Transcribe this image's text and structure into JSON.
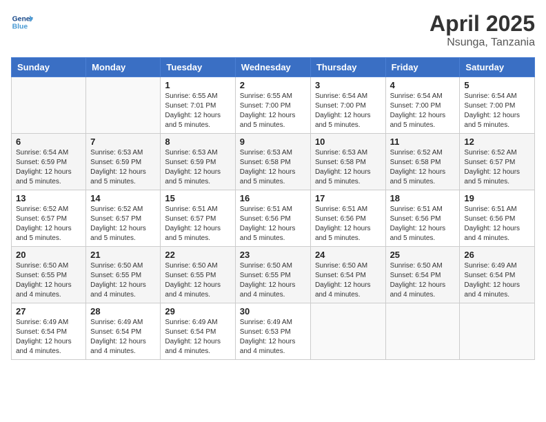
{
  "header": {
    "logo_line1": "General",
    "logo_line2": "Blue",
    "month": "April 2025",
    "location": "Nsunga, Tanzania"
  },
  "weekdays": [
    "Sunday",
    "Monday",
    "Tuesday",
    "Wednesday",
    "Thursday",
    "Friday",
    "Saturday"
  ],
  "weeks": [
    [
      {
        "num": "",
        "sunrise": "",
        "sunset": "",
        "daylight": ""
      },
      {
        "num": "",
        "sunrise": "",
        "sunset": "",
        "daylight": ""
      },
      {
        "num": "1",
        "sunrise": "Sunrise: 6:55 AM",
        "sunset": "Sunset: 7:01 PM",
        "daylight": "Daylight: 12 hours and 5 minutes."
      },
      {
        "num": "2",
        "sunrise": "Sunrise: 6:55 AM",
        "sunset": "Sunset: 7:00 PM",
        "daylight": "Daylight: 12 hours and 5 minutes."
      },
      {
        "num": "3",
        "sunrise": "Sunrise: 6:54 AM",
        "sunset": "Sunset: 7:00 PM",
        "daylight": "Daylight: 12 hours and 5 minutes."
      },
      {
        "num": "4",
        "sunrise": "Sunrise: 6:54 AM",
        "sunset": "Sunset: 7:00 PM",
        "daylight": "Daylight: 12 hours and 5 minutes."
      },
      {
        "num": "5",
        "sunrise": "Sunrise: 6:54 AM",
        "sunset": "Sunset: 7:00 PM",
        "daylight": "Daylight: 12 hours and 5 minutes."
      }
    ],
    [
      {
        "num": "6",
        "sunrise": "Sunrise: 6:54 AM",
        "sunset": "Sunset: 6:59 PM",
        "daylight": "Daylight: 12 hours and 5 minutes."
      },
      {
        "num": "7",
        "sunrise": "Sunrise: 6:53 AM",
        "sunset": "Sunset: 6:59 PM",
        "daylight": "Daylight: 12 hours and 5 minutes."
      },
      {
        "num": "8",
        "sunrise": "Sunrise: 6:53 AM",
        "sunset": "Sunset: 6:59 PM",
        "daylight": "Daylight: 12 hours and 5 minutes."
      },
      {
        "num": "9",
        "sunrise": "Sunrise: 6:53 AM",
        "sunset": "Sunset: 6:58 PM",
        "daylight": "Daylight: 12 hours and 5 minutes."
      },
      {
        "num": "10",
        "sunrise": "Sunrise: 6:53 AM",
        "sunset": "Sunset: 6:58 PM",
        "daylight": "Daylight: 12 hours and 5 minutes."
      },
      {
        "num": "11",
        "sunrise": "Sunrise: 6:52 AM",
        "sunset": "Sunset: 6:58 PM",
        "daylight": "Daylight: 12 hours and 5 minutes."
      },
      {
        "num": "12",
        "sunrise": "Sunrise: 6:52 AM",
        "sunset": "Sunset: 6:57 PM",
        "daylight": "Daylight: 12 hours and 5 minutes."
      }
    ],
    [
      {
        "num": "13",
        "sunrise": "Sunrise: 6:52 AM",
        "sunset": "Sunset: 6:57 PM",
        "daylight": "Daylight: 12 hours and 5 minutes."
      },
      {
        "num": "14",
        "sunrise": "Sunrise: 6:52 AM",
        "sunset": "Sunset: 6:57 PM",
        "daylight": "Daylight: 12 hours and 5 minutes."
      },
      {
        "num": "15",
        "sunrise": "Sunrise: 6:51 AM",
        "sunset": "Sunset: 6:57 PM",
        "daylight": "Daylight: 12 hours and 5 minutes."
      },
      {
        "num": "16",
        "sunrise": "Sunrise: 6:51 AM",
        "sunset": "Sunset: 6:56 PM",
        "daylight": "Daylight: 12 hours and 5 minutes."
      },
      {
        "num": "17",
        "sunrise": "Sunrise: 6:51 AM",
        "sunset": "Sunset: 6:56 PM",
        "daylight": "Daylight: 12 hours and 5 minutes."
      },
      {
        "num": "18",
        "sunrise": "Sunrise: 6:51 AM",
        "sunset": "Sunset: 6:56 PM",
        "daylight": "Daylight: 12 hours and 5 minutes."
      },
      {
        "num": "19",
        "sunrise": "Sunrise: 6:51 AM",
        "sunset": "Sunset: 6:56 PM",
        "daylight": "Daylight: 12 hours and 4 minutes."
      }
    ],
    [
      {
        "num": "20",
        "sunrise": "Sunrise: 6:50 AM",
        "sunset": "Sunset: 6:55 PM",
        "daylight": "Daylight: 12 hours and 4 minutes."
      },
      {
        "num": "21",
        "sunrise": "Sunrise: 6:50 AM",
        "sunset": "Sunset: 6:55 PM",
        "daylight": "Daylight: 12 hours and 4 minutes."
      },
      {
        "num": "22",
        "sunrise": "Sunrise: 6:50 AM",
        "sunset": "Sunset: 6:55 PM",
        "daylight": "Daylight: 12 hours and 4 minutes."
      },
      {
        "num": "23",
        "sunrise": "Sunrise: 6:50 AM",
        "sunset": "Sunset: 6:55 PM",
        "daylight": "Daylight: 12 hours and 4 minutes."
      },
      {
        "num": "24",
        "sunrise": "Sunrise: 6:50 AM",
        "sunset": "Sunset: 6:54 PM",
        "daylight": "Daylight: 12 hours and 4 minutes."
      },
      {
        "num": "25",
        "sunrise": "Sunrise: 6:50 AM",
        "sunset": "Sunset: 6:54 PM",
        "daylight": "Daylight: 12 hours and 4 minutes."
      },
      {
        "num": "26",
        "sunrise": "Sunrise: 6:49 AM",
        "sunset": "Sunset: 6:54 PM",
        "daylight": "Daylight: 12 hours and 4 minutes."
      }
    ],
    [
      {
        "num": "27",
        "sunrise": "Sunrise: 6:49 AM",
        "sunset": "Sunset: 6:54 PM",
        "daylight": "Daylight: 12 hours and 4 minutes."
      },
      {
        "num": "28",
        "sunrise": "Sunrise: 6:49 AM",
        "sunset": "Sunset: 6:54 PM",
        "daylight": "Daylight: 12 hours and 4 minutes."
      },
      {
        "num": "29",
        "sunrise": "Sunrise: 6:49 AM",
        "sunset": "Sunset: 6:54 PM",
        "daylight": "Daylight: 12 hours and 4 minutes."
      },
      {
        "num": "30",
        "sunrise": "Sunrise: 6:49 AM",
        "sunset": "Sunset: 6:53 PM",
        "daylight": "Daylight: 12 hours and 4 minutes."
      },
      {
        "num": "",
        "sunrise": "",
        "sunset": "",
        "daylight": ""
      },
      {
        "num": "",
        "sunrise": "",
        "sunset": "",
        "daylight": ""
      },
      {
        "num": "",
        "sunrise": "",
        "sunset": "",
        "daylight": ""
      }
    ]
  ]
}
